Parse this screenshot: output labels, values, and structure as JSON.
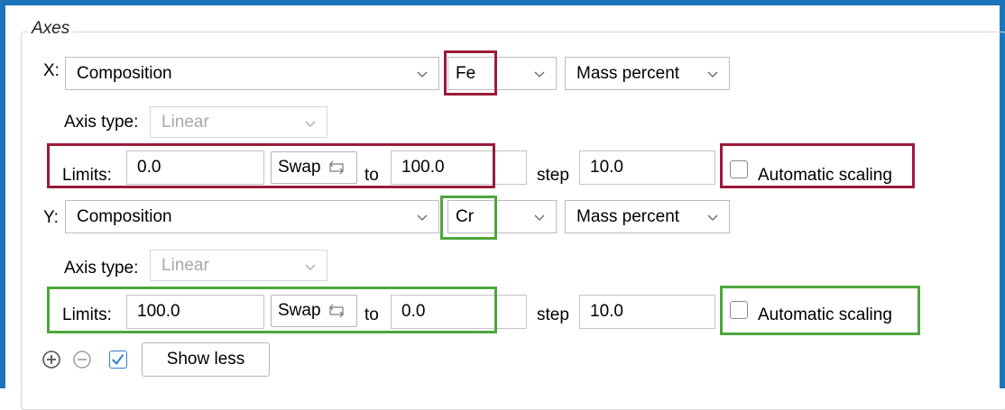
{
  "group_title": "Axes",
  "x_axis": {
    "label": "X:",
    "quantity": "Composition",
    "element": "Fe",
    "unit": "Mass percent",
    "axis_type_label": "Axis type:",
    "axis_type": "Linear",
    "limits_label": "Limits:",
    "limit_from": "0.0",
    "swap_label": "Swap",
    "to_label": "to",
    "limit_to": "100.0",
    "step_label": "step",
    "step": "10.0",
    "auto_scaling_label": "Automatic scaling",
    "auto_scaling_checked": false
  },
  "y_axis": {
    "label": "Y:",
    "quantity": "Composition",
    "element": "Cr",
    "unit": "Mass percent",
    "axis_type_label": "Axis type:",
    "axis_type": "Linear",
    "limits_label": "Limits:",
    "limit_from": "100.0",
    "swap_label": "Swap",
    "to_label": "to",
    "limit_to": "0.0",
    "step_label": "step",
    "step": "10.0",
    "auto_scaling_label": "Automatic scaling",
    "auto_scaling_checked": false
  },
  "footer": {
    "show_less_label": "Show less",
    "show_less_checked": true
  },
  "colors": {
    "frame": "#1b75bc",
    "highlight_red": "#9b1b3a",
    "highlight_green": "#4ea63b",
    "checkbox_accent": "#2f7fd0"
  }
}
